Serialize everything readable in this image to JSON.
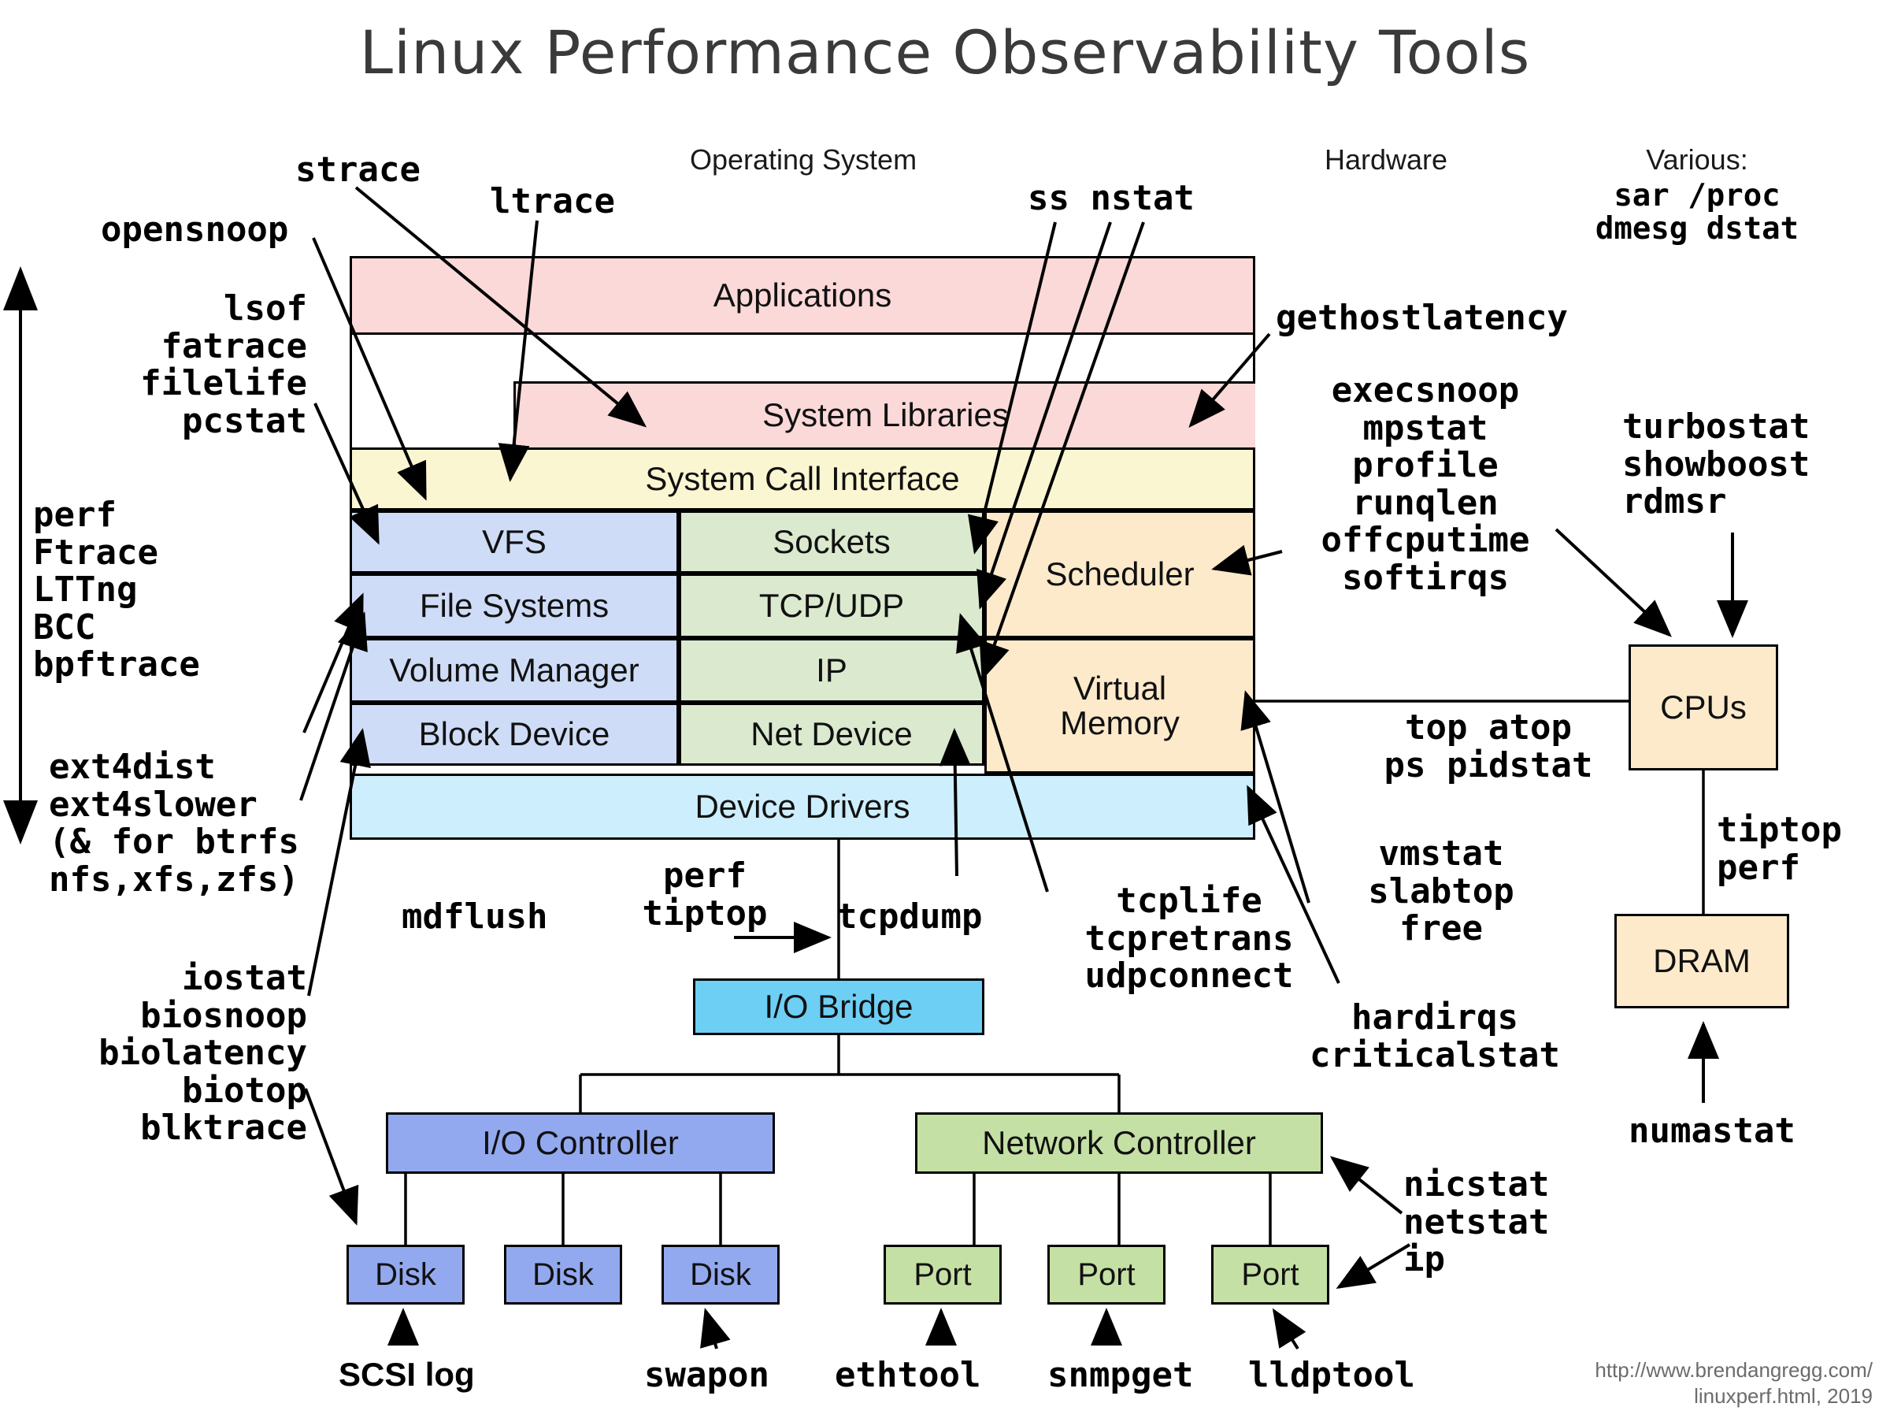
{
  "title": "Linux Performance Observability Tools",
  "sections": {
    "operating_system": "Operating System",
    "hardware": "Hardware",
    "various_header": "Various:",
    "various_tools": "sar /proc\ndmesg dstat"
  },
  "stack": {
    "applications": "Applications",
    "system_libraries": "System Libraries",
    "system_call_interface": "System Call Interface",
    "vfs": "VFS",
    "file_systems": "File Systems",
    "volume_manager": "Volume Manager",
    "block_device": "Block Device",
    "sockets": "Sockets",
    "tcp_udp": "TCP/UDP",
    "ip": "IP",
    "net_device": "Net Device",
    "scheduler": "Scheduler",
    "virtual_memory": "Virtual\nMemory",
    "device_drivers": "Device Drivers"
  },
  "hardware_boxes": {
    "cpus": "CPUs",
    "dram": "DRAM",
    "io_bridge": "I/O Bridge",
    "io_controller": "I/O Controller",
    "network_controller": "Network Controller",
    "disk_1": "Disk",
    "disk_2": "Disk",
    "disk_3": "Disk",
    "port_1": "Port",
    "port_2": "Port",
    "port_3": "Port"
  },
  "tool_labels": {
    "strace": "strace",
    "ltrace": "ltrace",
    "opensnoop": "opensnoop",
    "ss_nstat": "ss nstat",
    "file_tools": "lsof\nfatrace\nfilelife\npcstat",
    "tracers": "perf\nFtrace\nLTTng\nBCC\nbpftrace",
    "ext4_tools": "ext4dist\next4slower\n(& for btrfs\nnfs,xfs,zfs)",
    "block_tools": "iostat\nbiosnoop\nbiolatency\nbiotop\nblktrace",
    "gethostlatency": "gethostlatency",
    "cpu_tools": "execsnoop\nmpstat\nprofile\nrunqlen\noffcputime\nsoftirqs",
    "turbostat_group": "turbostat\nshowboost\nrdmsr",
    "proc_tools": "top atop\nps pidstat",
    "mem_tools": "vmstat\nslabtop\nfree",
    "irq_tools": "hardirqs\ncriticalstat",
    "tiptop_perf": "tiptop\nperf",
    "numastat": "numastat",
    "mdflush": "mdflush",
    "perf_tiptop": "perf\ntiptop",
    "tcpdump": "tcpdump",
    "tcp_tools": "tcplife\ntcpretrans\nudpconnect",
    "nic_tools": "nicstat\nnetstat\nip",
    "scsi_log": "SCSI log",
    "swapon": "swapon",
    "ethtool": "ethtool",
    "snmpget": "snmpget",
    "lldptool": "lldptool"
  },
  "footer": {
    "url_line1": "http://www.brendangregg.com/",
    "url_line2": "linuxperf.html, 2019"
  },
  "colors": {
    "applications": "#fcd9d9",
    "syscall": "#fbf6d2",
    "filesystem": "#cfdcf7",
    "network": "#dbe9cf",
    "kernel_misc": "#fceacb",
    "device_drivers": "#cdeefc",
    "io_bridge": "#6ecff5",
    "io_controller": "#93a9ef",
    "network_controller": "#c5e0a4",
    "title_text": "#3a3a3a",
    "url_text": "#6b6b6b"
  }
}
